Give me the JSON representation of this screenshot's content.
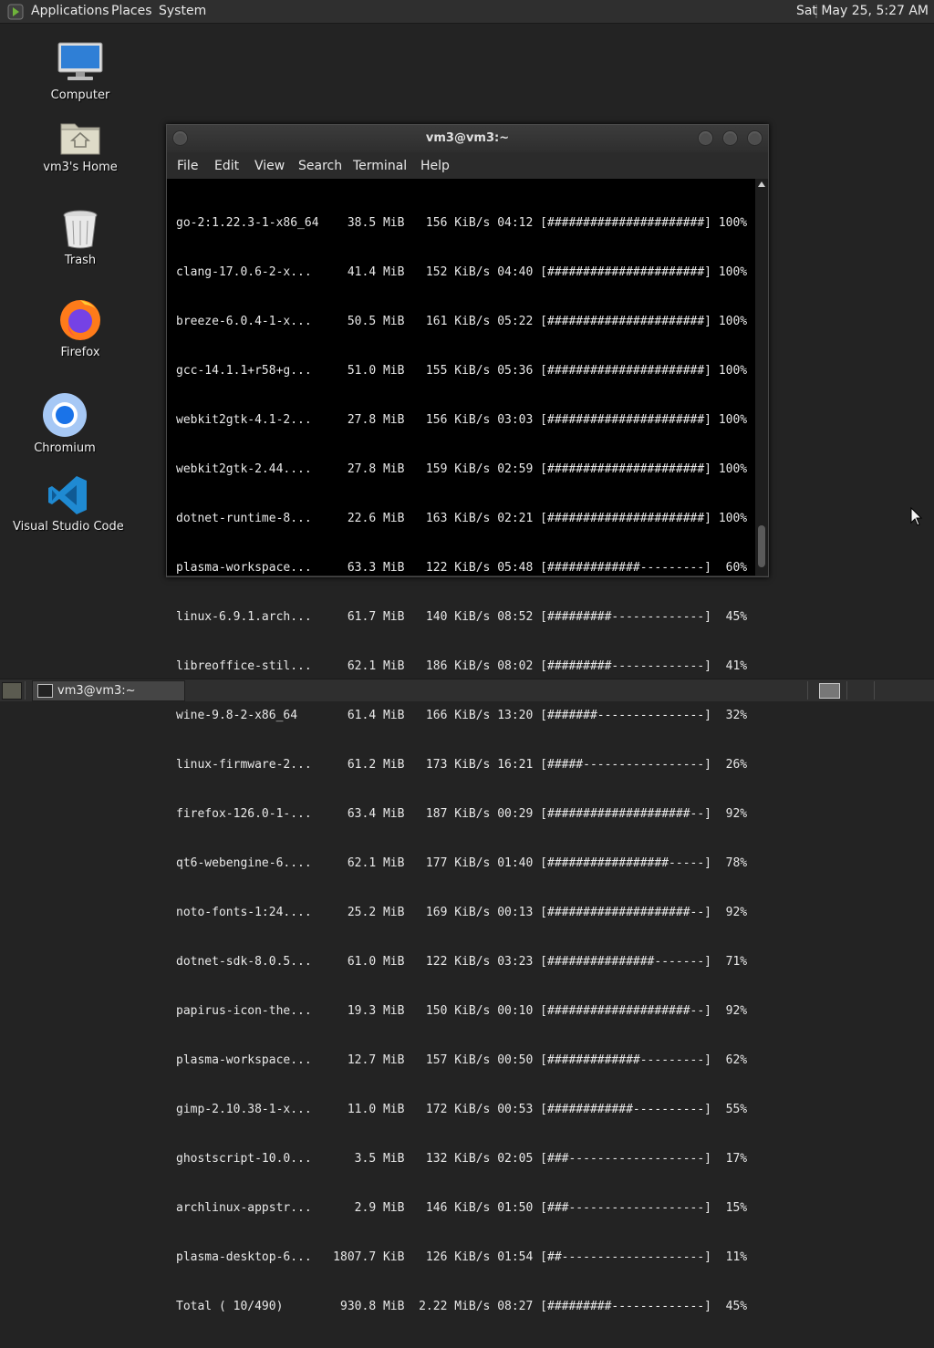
{
  "top_panel": {
    "menus": [
      "Applications",
      "Places",
      "System"
    ],
    "clock": "Sat May 25,  5:27 AM"
  },
  "desktop_icons": [
    {
      "label": "Computer",
      "icon": "computer-icon"
    },
    {
      "label": "vm3's Home",
      "icon": "home-folder-icon"
    },
    {
      "label": "Trash",
      "icon": "trash-icon"
    },
    {
      "label": "Firefox",
      "icon": "firefox-icon"
    },
    {
      "label": "Chromium",
      "icon": "chromium-icon"
    },
    {
      "label": "Visual Studio Code",
      "icon": "vscode-icon"
    }
  ],
  "terminal": {
    "title": "vm3@vm3:~",
    "menu": [
      "File",
      "Edit",
      "View",
      "Search",
      "Terminal",
      "Help"
    ],
    "lines": [
      "go-2:1.22.3-1-x86_64    38.5 MiB   156 KiB/s 04:12 [######################] 100%",
      "clang-17.0.6-2-x...     41.4 MiB   152 KiB/s 04:40 [######################] 100%",
      "breeze-6.0.4-1-x...     50.5 MiB   161 KiB/s 05:22 [######################] 100%",
      "gcc-14.1.1+r58+g...     51.0 MiB   155 KiB/s 05:36 [######################] 100%",
      "webkit2gtk-4.1-2...     27.8 MiB   156 KiB/s 03:03 [######################] 100%",
      "webkit2gtk-2.44....     27.8 MiB   159 KiB/s 02:59 [######################] 100%",
      "dotnet-runtime-8...     22.6 MiB   163 KiB/s 02:21 [######################] 100%",
      "plasma-workspace...     63.3 MiB   122 KiB/s 05:48 [#############---------]  60%",
      "linux-6.9.1.arch...     61.7 MiB   140 KiB/s 08:52 [#########-------------]  45%",
      "libreoffice-stil...     62.1 MiB   186 KiB/s 08:02 [#########-------------]  41%",
      "wine-9.8-2-x86_64       61.4 MiB   166 KiB/s 13:20 [#######---------------]  32%",
      "linux-firmware-2...     61.2 MiB   173 KiB/s 16:21 [#####-----------------]  26%",
      "firefox-126.0-1-...     63.4 MiB   187 KiB/s 00:29 [####################--]  92%",
      "qt6-webengine-6....     62.1 MiB   177 KiB/s 01:40 [#################-----]  78%",
      "noto-fonts-1:24....     25.2 MiB   169 KiB/s 00:13 [####################--]  92%",
      "dotnet-sdk-8.0.5...     61.0 MiB   122 KiB/s 03:23 [###############-------]  71%",
      "papirus-icon-the...     19.3 MiB   150 KiB/s 00:10 [####################--]  92%",
      "plasma-workspace...     12.7 MiB   157 KiB/s 00:50 [#############---------]  62%",
      "gimp-2.10.38-1-x...     11.0 MiB   172 KiB/s 00:53 [############----------]  55%",
      "ghostscript-10.0...      3.5 MiB   132 KiB/s 02:05 [###-------------------]  17%",
      "archlinux-appstr...      2.9 MiB   146 KiB/s 01:50 [###-------------------]  15%",
      "plasma-desktop-6...   1807.7 KiB   126 KiB/s 01:54 [##--------------------]  11%",
      "Total ( 10/490)        930.8 MiB  2.22 MiB/s 08:27 [#########-------------]  45%"
    ]
  },
  "taskbar": {
    "window_label": "vm3@vm3:~"
  },
  "colors": {
    "desktop_bg": "#232323",
    "panel_bg": "#2f2f2f",
    "terminal_bg": "#000000",
    "terminal_fg": "#e8e8e8"
  }
}
